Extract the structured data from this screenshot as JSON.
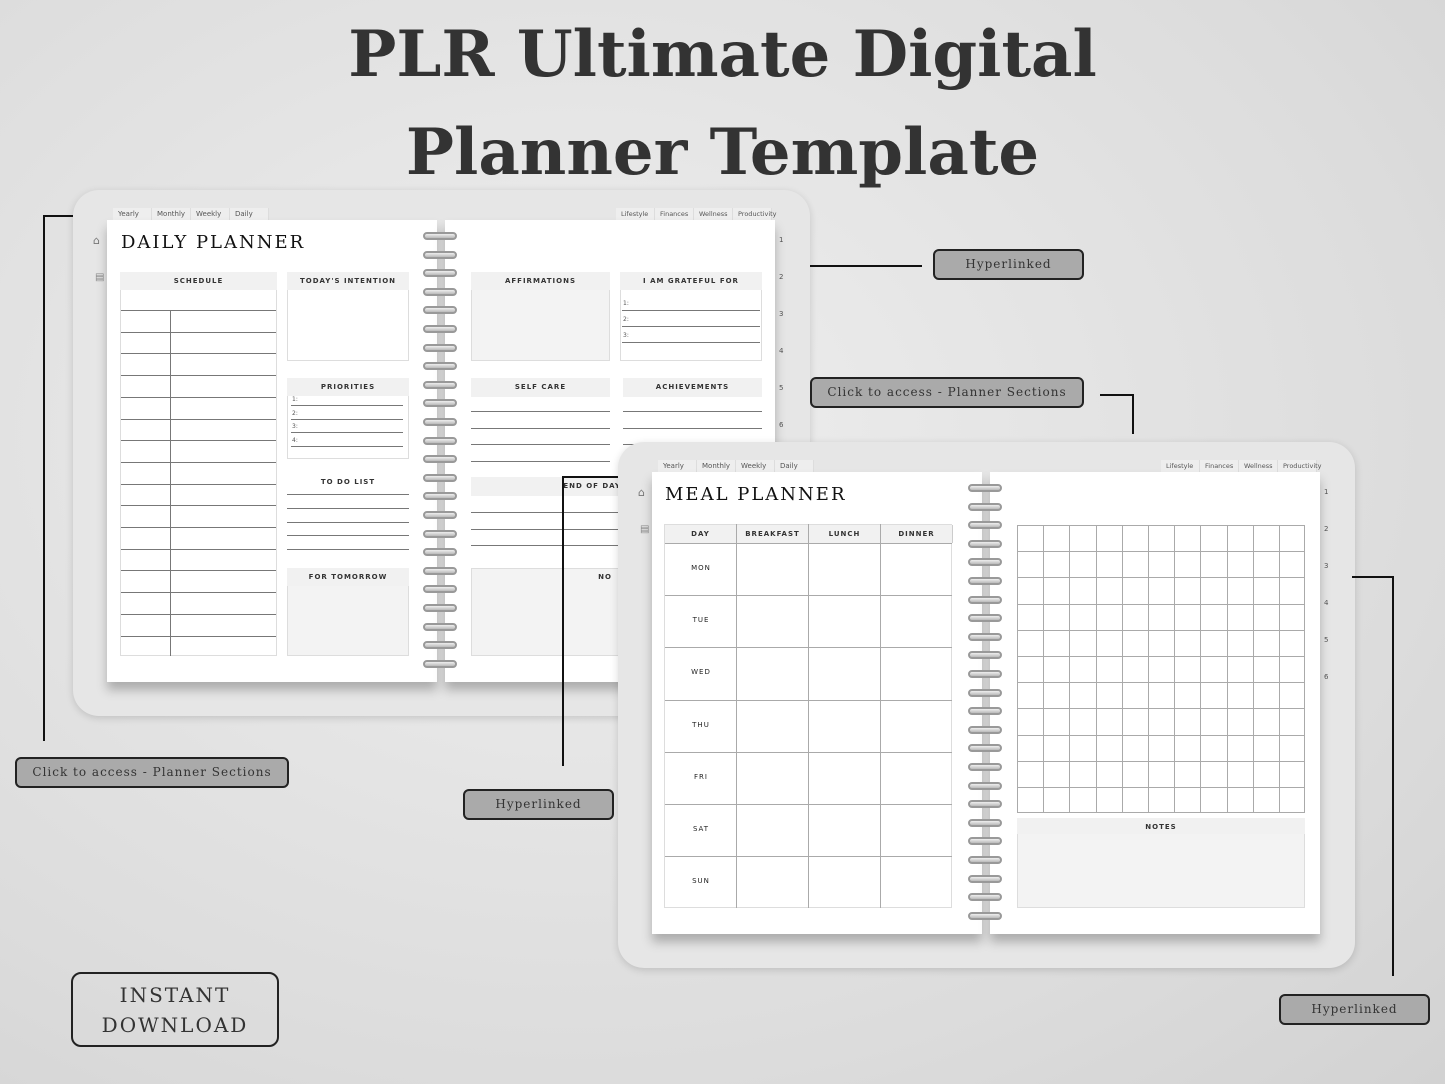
{
  "title": {
    "line1": "PLR Ultimate Digital",
    "line2": "Planner Template"
  },
  "tabs_top": [
    "Yearly",
    "Monthly",
    "Weekly",
    "Daily"
  ],
  "tabs_right": [
    "Lifestyle",
    "Finances",
    "Wellness",
    "Productivity"
  ],
  "side_numbers": [
    "1",
    "2",
    "3",
    "4",
    "5",
    "6"
  ],
  "daily": {
    "title": "DAILY PLANNER",
    "schedule": "SCHEDULE",
    "intention": "TODAY'S INTENTION",
    "priorities": "PRIORITIES",
    "priority_nums": [
      "1:",
      "2:",
      "3:",
      "4:"
    ],
    "todo": "TO DO LIST",
    "tomorrow": "FOR TOMORROW",
    "affirmations": "AFFIRMATIONS",
    "grateful": "I AM GRATEFUL FOR",
    "grateful_nums": [
      "1:",
      "2:",
      "3:"
    ],
    "selfcare": "SELF CARE",
    "achievements": "ACHIEVEMENTS",
    "endofday": "END OF DAY",
    "notes": "NO"
  },
  "meal": {
    "title": "MEAL PLANNER",
    "columns": [
      "DAY",
      "BREAKFAST",
      "LUNCH",
      "DINNER"
    ],
    "days": [
      "MON",
      "TUE",
      "WED",
      "THU",
      "FRI",
      "SAT",
      "SUN"
    ],
    "notes": "NOTES"
  },
  "callouts": {
    "hyperlinked": "Hyperlinked",
    "sections": "Click to access - Planner Sections",
    "instant": "INSTANT",
    "download": "DOWNLOAD"
  },
  "icons": [
    "home-icon",
    "clipboard-icon",
    "arrow-icon"
  ]
}
